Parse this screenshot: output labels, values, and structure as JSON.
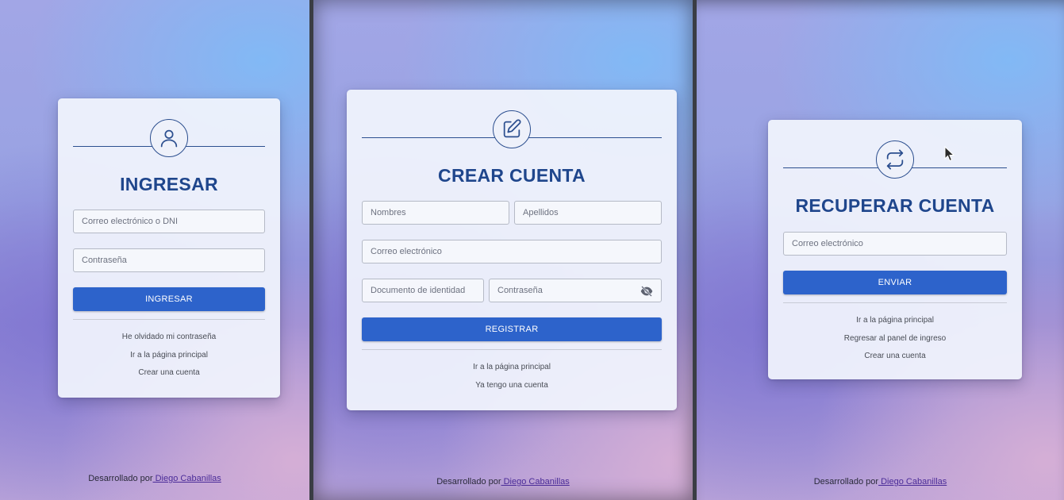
{
  "login": {
    "title": "INGRESAR",
    "email_placeholder": "Correo electrónico o DNI",
    "password_placeholder": "Contraseña",
    "submit_label": "INGRESAR",
    "links": [
      "He olvidado mi contraseña",
      "Ir a la página principal",
      "Crear una cuenta"
    ]
  },
  "register": {
    "title": "CREAR CUENTA",
    "names_placeholder": "Nombres",
    "surnames_placeholder": "Apellidos",
    "email_placeholder": "Correo electrónico",
    "document_placeholder": "Documento de identidad",
    "password_placeholder": "Contraseña",
    "submit_label": "REGISTRAR",
    "links": [
      "Ir a la página principal",
      "Ya tengo una cuenta"
    ]
  },
  "recover": {
    "title": "RECUPERAR CUENTA",
    "email_placeholder": "Correo electrónico",
    "submit_label": "ENVIAR",
    "links": [
      "Ir a la página principal",
      "Regresar al panel de ingreso",
      "Crear una cuenta"
    ]
  },
  "footer": {
    "prefix": "Desarrollado por",
    "author": " Diego Cabanillas"
  },
  "icons": {
    "login": "user-icon",
    "register": "edit-icon",
    "recover": "repeat-icon",
    "password_toggle": "eye-off-icon"
  },
  "colors": {
    "accent": "#2d63cb",
    "title": "#1f468c",
    "link": "#4a2b98"
  }
}
